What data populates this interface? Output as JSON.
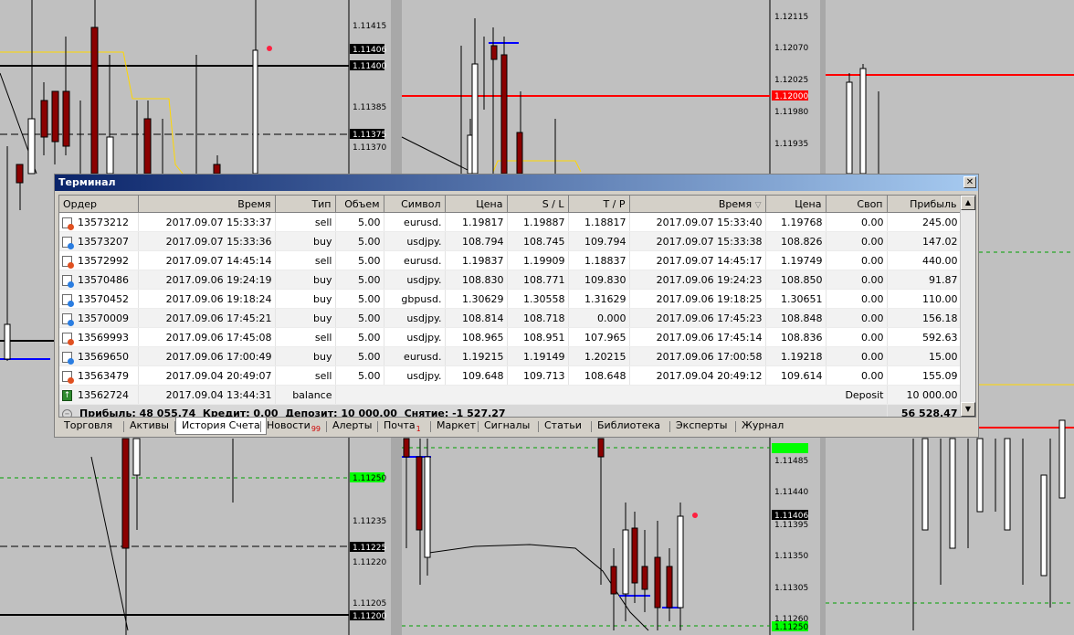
{
  "charts": {
    "left_axis": [
      "1.11415",
      "1.11406",
      "1.11400",
      "1.11385",
      "1.11375",
      "1.11370",
      "1.11250",
      "1.11235",
      "1.11225",
      "1.11220",
      "1.11205",
      "1.11200"
    ],
    "middle_axis": [
      "1.12115",
      "1.12070",
      "1.12025",
      "1.12000",
      "1.11980",
      "1.11935",
      "1.11485",
      "1.11440",
      "1.11406",
      "1.11395",
      "1.11350",
      "1.11305",
      "1.11260",
      "1.11250"
    ]
  },
  "terminal": {
    "title": "Терминал",
    "columns": [
      "Ордер",
      "Время",
      "Тип",
      "Объем",
      "Символ",
      "Цена",
      "S / L",
      "T / P",
      "Время",
      "Цена",
      "Своп",
      "Прибыль"
    ],
    "sort_indicator": "▽",
    "rows": [
      {
        "order": "13573212",
        "time": "2017.09.07 15:33:37",
        "type": "sell",
        "volume": "5.00",
        "symbol": "eurusd.",
        "price": "1.19817",
        "sl": "1.19887",
        "tp": "1.18817",
        "close_time": "2017.09.07 15:33:40",
        "close_price": "1.19768",
        "swap": "0.00",
        "profit": "245.00"
      },
      {
        "order": "13573207",
        "time": "2017.09.07 15:33:36",
        "type": "buy",
        "volume": "5.00",
        "symbol": "usdjpy.",
        "price": "108.794",
        "sl": "108.745",
        "tp": "109.794",
        "close_time": "2017.09.07 15:33:38",
        "close_price": "108.826",
        "swap": "0.00",
        "profit": "147.02"
      },
      {
        "order": "13572992",
        "time": "2017.09.07 14:45:14",
        "type": "sell",
        "volume": "5.00",
        "symbol": "eurusd.",
        "price": "1.19837",
        "sl": "1.19909",
        "tp": "1.18837",
        "close_time": "2017.09.07 14:45:17",
        "close_price": "1.19749",
        "swap": "0.00",
        "profit": "440.00"
      },
      {
        "order": "13570486",
        "time": "2017.09.06 19:24:19",
        "type": "buy",
        "volume": "5.00",
        "symbol": "usdjpy.",
        "price": "108.830",
        "sl": "108.771",
        "tp": "109.830",
        "close_time": "2017.09.06 19:24:23",
        "close_price": "108.850",
        "swap": "0.00",
        "profit": "91.87"
      },
      {
        "order": "13570452",
        "time": "2017.09.06 19:18:24",
        "type": "buy",
        "volume": "5.00",
        "symbol": "gbpusd.",
        "price": "1.30629",
        "sl": "1.30558",
        "tp": "1.31629",
        "close_time": "2017.09.06 19:18:25",
        "close_price": "1.30651",
        "swap": "0.00",
        "profit": "110.00"
      },
      {
        "order": "13570009",
        "time": "2017.09.06 17:45:21",
        "type": "buy",
        "volume": "5.00",
        "symbol": "usdjpy.",
        "price": "108.814",
        "sl": "108.718",
        "tp": "0.000",
        "close_time": "2017.09.06 17:45:23",
        "close_price": "108.848",
        "swap": "0.00",
        "profit": "156.18"
      },
      {
        "order": "13569993",
        "time": "2017.09.06 17:45:08",
        "type": "sell",
        "volume": "5.00",
        "symbol": "usdjpy.",
        "price": "108.965",
        "sl": "108.951",
        "tp": "107.965",
        "close_time": "2017.09.06 17:45:14",
        "close_price": "108.836",
        "swap": "0.00",
        "profit": "592.63"
      },
      {
        "order": "13569650",
        "time": "2017.09.06 17:00:49",
        "type": "buy",
        "volume": "5.00",
        "symbol": "eurusd.",
        "price": "1.19215",
        "sl": "1.19149",
        "tp": "1.20215",
        "close_time": "2017.09.06 17:00:58",
        "close_price": "1.19218",
        "swap": "0.00",
        "profit": "15.00"
      },
      {
        "order": "13563479",
        "time": "2017.09.04 20:49:07",
        "type": "sell",
        "volume": "5.00",
        "symbol": "usdjpy.",
        "price": "109.648",
        "sl": "109.713",
        "tp": "108.648",
        "close_time": "2017.09.04 20:49:12",
        "close_price": "109.614",
        "swap": "0.00",
        "profit": "155.09"
      }
    ],
    "balance_row": {
      "order": "13562724",
      "time": "2017.09.04 13:44:31",
      "type": "balance",
      "comment": "Deposit",
      "profit": "10 000.00"
    },
    "summary": {
      "text": "Прибыль: 48 055.74  Кредит: 0.00  Депозит: 10 000.00  Снятие: -1 527.27",
      "total": "56 528.47"
    },
    "tabs": [
      {
        "label": "Торговля",
        "active": false
      },
      {
        "label": "Активы",
        "active": false
      },
      {
        "label": "История Счета",
        "active": true
      },
      {
        "label": "Новости",
        "badge": "99",
        "active": false
      },
      {
        "label": "Алерты",
        "active": false
      },
      {
        "label": "Почта",
        "badge": "1",
        "active": false
      },
      {
        "label": "Маркет",
        "active": false
      },
      {
        "label": "Сигналы",
        "active": false
      },
      {
        "label": "Статьи",
        "active": false
      },
      {
        "label": "Библиотека",
        "active": false
      },
      {
        "label": "Эксперты",
        "active": false
      },
      {
        "label": "Журнал",
        "active": false
      }
    ],
    "colors": {
      "title_bar_start": "#0a246a",
      "title_bar_end": "#a6caf0",
      "chart_bg": "#c0c0c0",
      "sl_line": "#ff0000",
      "ma_line": "#ffd700",
      "candle_down": "#8b0000"
    }
  }
}
